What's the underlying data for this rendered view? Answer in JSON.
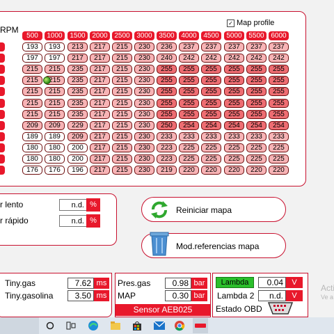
{
  "map": {
    "rpm_label": "RPM",
    "map_profile_label": "Map profile",
    "map_profile_checked": true,
    "rpm_headers": [
      "500",
      "1000",
      "1500",
      "2000",
      "2500",
      "3000",
      "3500",
      "4000",
      "4500",
      "5000",
      "5500",
      "6000"
    ],
    "rows": [
      [
        "193",
        "193",
        "213",
        "217",
        "215",
        "230",
        "236",
        "237",
        "237",
        "237",
        "237",
        "237"
      ],
      [
        "197",
        "197",
        "217",
        "217",
        "215",
        "230",
        "240",
        "242",
        "242",
        "242",
        "242",
        "242"
      ],
      [
        "215",
        "215",
        "235",
        "217",
        "215",
        "230",
        "255",
        "255",
        "255",
        "255",
        "255",
        "255"
      ],
      [
        "215",
        "215",
        "235",
        "217",
        "215",
        "230",
        "255",
        "255",
        "255",
        "255",
        "255",
        "255"
      ],
      [
        "215",
        "215",
        "235",
        "217",
        "215",
        "230",
        "255",
        "255",
        "255",
        "255",
        "255",
        "255"
      ],
      [
        "215",
        "215",
        "235",
        "217",
        "215",
        "230",
        "255",
        "255",
        "255",
        "255",
        "255",
        "255"
      ],
      [
        "215",
        "215",
        "235",
        "217",
        "215",
        "230",
        "255",
        "255",
        "255",
        "255",
        "255",
        "255"
      ],
      [
        "209",
        "209",
        "229",
        "217",
        "215",
        "230",
        "250",
        "254",
        "254",
        "254",
        "254",
        "254"
      ],
      [
        "189",
        "189",
        "209",
        "217",
        "215",
        "230",
        "233",
        "233",
        "233",
        "233",
        "233",
        "233"
      ],
      [
        "180",
        "180",
        "200",
        "217",
        "215",
        "230",
        "223",
        "225",
        "225",
        "225",
        "225",
        "225"
      ],
      [
        "180",
        "180",
        "200",
        "217",
        "215",
        "230",
        "223",
        "225",
        "225",
        "225",
        "225",
        "225"
      ],
      [
        "176",
        "176",
        "196",
        "217",
        "215",
        "230",
        "219",
        "220",
        "220",
        "220",
        "220",
        "220"
      ]
    ],
    "row_colors": [
      [
        "w",
        "w",
        "p",
        "p",
        "p",
        "p",
        "p",
        "p",
        "p",
        "p",
        "p",
        "p"
      ],
      [
        "w",
        "w",
        "p",
        "p",
        "p",
        "p",
        "p",
        "p",
        "p",
        "p",
        "p",
        "p"
      ],
      [
        "p",
        "p",
        "p",
        "p",
        "p",
        "p",
        "r",
        "r",
        "r",
        "r",
        "r",
        "r"
      ],
      [
        "p",
        "p",
        "p",
        "p",
        "p",
        "p",
        "r",
        "r",
        "r",
        "r",
        "r",
        "r"
      ],
      [
        "p",
        "p",
        "p",
        "p",
        "p",
        "p",
        "r",
        "r",
        "r",
        "r",
        "r",
        "r"
      ],
      [
        "p",
        "p",
        "p",
        "p",
        "p",
        "p",
        "r",
        "r",
        "r",
        "r",
        "r",
        "r"
      ],
      [
        "p",
        "p",
        "p",
        "p",
        "p",
        "p",
        "r",
        "r",
        "r",
        "r",
        "r",
        "r"
      ],
      [
        "p",
        "p",
        "p",
        "p",
        "p",
        "p",
        "r",
        "r",
        "r",
        "r",
        "r",
        "r"
      ],
      [
        "w",
        "w",
        "p",
        "p",
        "p",
        "p",
        "p",
        "p",
        "p",
        "p",
        "p",
        "p"
      ],
      [
        "w",
        "w",
        "w",
        "p",
        "p",
        "p",
        "p",
        "p",
        "p",
        "p",
        "p",
        "p"
      ],
      [
        "w",
        "w",
        "w",
        "p",
        "p",
        "p",
        "p",
        "p",
        "p",
        "p",
        "p",
        "p"
      ],
      [
        "w",
        "w",
        "w",
        "p",
        "p",
        "p",
        "p",
        "p",
        "p",
        "p",
        "p",
        "p"
      ]
    ]
  },
  "injectors": {
    "slow_label": "r lento",
    "slow_value": "n.d.",
    "slow_unit": "%",
    "fast_label": "r rápido",
    "fast_value": "n.d.",
    "fast_unit": "%"
  },
  "actions": {
    "reset_label": "Reiniciar mapa",
    "reset_icon": "refresh-arrows-icon",
    "modref_label": "Mod.referencias mapa",
    "modref_icon": "trash-bin-icon"
  },
  "readouts": {
    "tiny_gas_label": "Tiny.gas",
    "tiny_gas_value": "7.62",
    "tiny_gas_unit": "ms",
    "tiny_gasolina_label": "Tiny.gasolina",
    "tiny_gasolina_value": "3.50",
    "tiny_gasolina_unit": "ms",
    "pres_gas_label": "Pres.gas",
    "pres_gas_value": "0.98",
    "pres_gas_unit": "bar",
    "map_label": "MAP",
    "map_value": "0.30",
    "map_unit": "bar",
    "sensor_label": "Sensor AEB025",
    "lambda_label": "Lambda",
    "lambda_value": "0.04",
    "lambda_unit": "V",
    "lambda2_label": "Lambda 2",
    "lambda2_value": "n.d.",
    "lambda2_unit": "V",
    "obd_label": "Estado OBD"
  },
  "watermark": {
    "line1": "Acti",
    "line2": "Ve a"
  },
  "taskbar": {
    "icons": [
      "start-circle-icon",
      "task-view-icon",
      "edge-browser-icon",
      "file-explorer-icon",
      "store-icon",
      "mail-icon",
      "chrome-icon",
      "app-icon"
    ]
  },
  "colors": {
    "accent": "#e8182b",
    "cell_pink": "#f7b4b6",
    "cell_red": "#ee6d72",
    "lambda_green": "#2bbf2b"
  }
}
